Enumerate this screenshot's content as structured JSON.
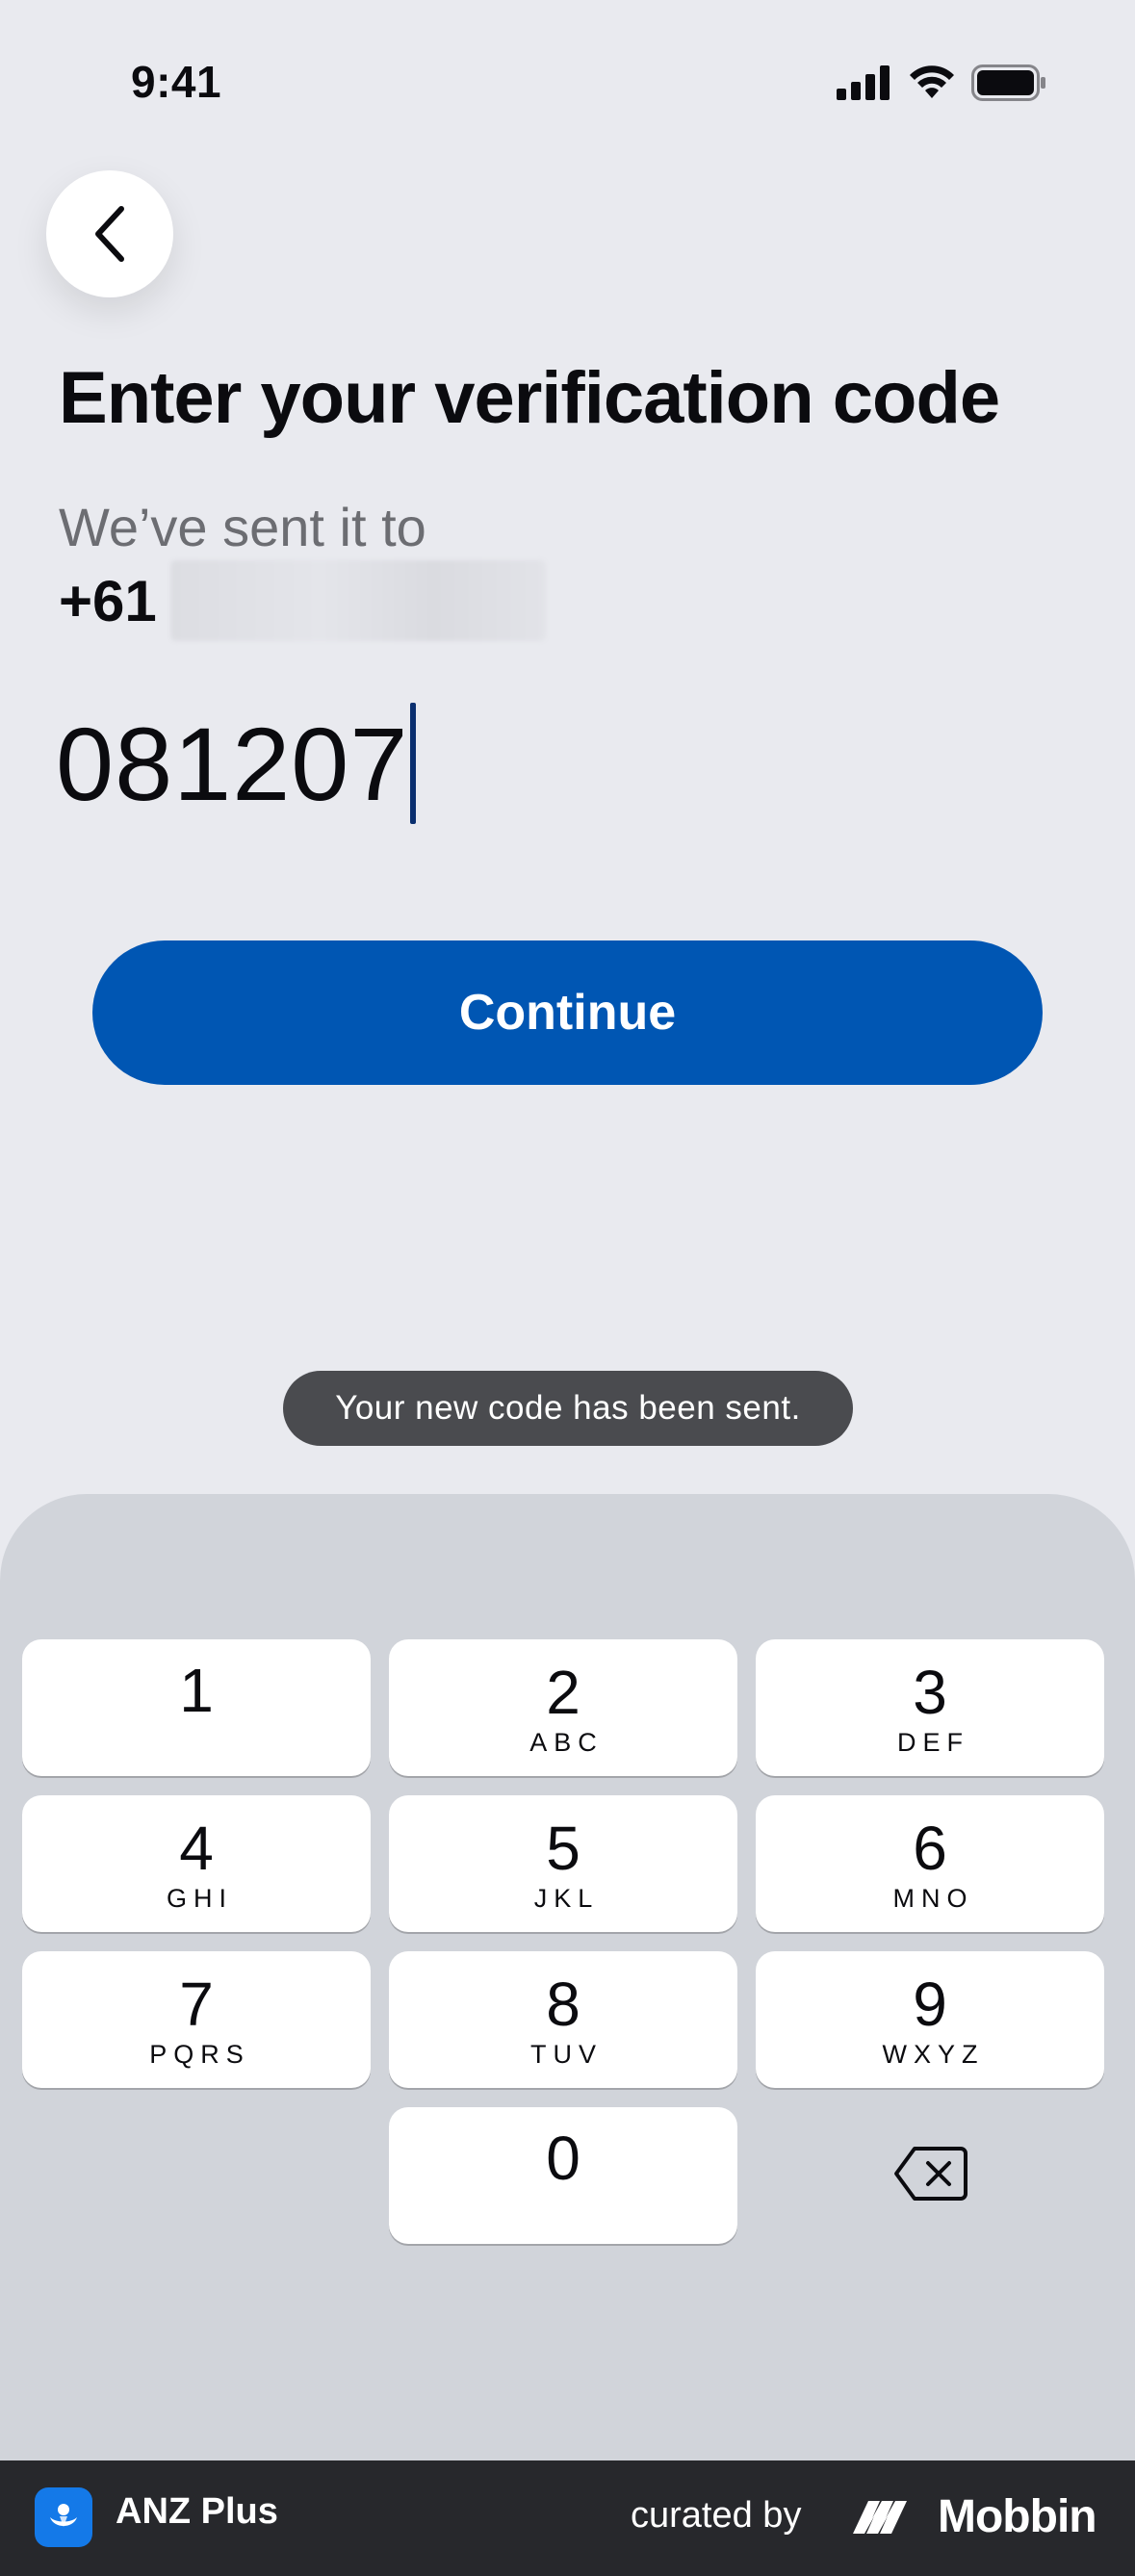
{
  "status_bar": {
    "time": "9:41"
  },
  "header": {
    "back_icon": "chevron-left-icon"
  },
  "main": {
    "title": "Enter your verification code",
    "subtitle": "We’ve sent it to",
    "phone_prefix": "+61",
    "code_value": "081207",
    "continue_label": "Continue"
  },
  "toast": {
    "message": "Your new code has been sent."
  },
  "keypad": {
    "keys": [
      {
        "digit": "1",
        "letters": ""
      },
      {
        "digit": "2",
        "letters": "ABC"
      },
      {
        "digit": "3",
        "letters": "DEF"
      },
      {
        "digit": "4",
        "letters": "GHI"
      },
      {
        "digit": "5",
        "letters": "JKL"
      },
      {
        "digit": "6",
        "letters": "MNO"
      },
      {
        "digit": "7",
        "letters": "PQRS"
      },
      {
        "digit": "8",
        "letters": "TUV"
      },
      {
        "digit": "9",
        "letters": "WXYZ"
      },
      {
        "digit": "0",
        "letters": ""
      }
    ],
    "delete_icon": "backspace-icon"
  },
  "footer": {
    "app_name": "ANZ Plus",
    "curated_by": "curated by",
    "brand": "Mobbin"
  },
  "colors": {
    "background": "#e9eaef",
    "primary_button": "#0056b3",
    "toast": "#4a4b4f",
    "keypad": "#d1d4da",
    "footer": "#27282c",
    "app_logo": "#1479e8"
  }
}
